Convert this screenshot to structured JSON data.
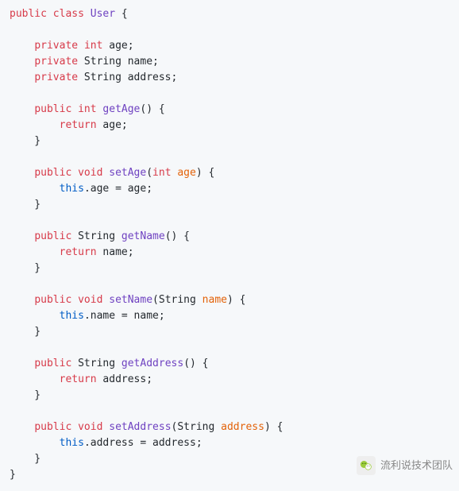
{
  "styles": {
    "kw": "#d73a49",
    "type": "#d73a49",
    "cls": "#6f42c1",
    "fn": "#6f42c1",
    "param": "#e36209",
    "this": "#005cc5",
    "plain": "#24292e"
  },
  "code": {
    "indent": "    ",
    "lines": [
      [
        [
          "kw",
          "public"
        ],
        [
          "plain",
          " "
        ],
        [
          "kw",
          "class"
        ],
        [
          "plain",
          " "
        ],
        [
          "cls",
          "User"
        ],
        [
          "plain",
          " {"
        ]
      ],
      [],
      [
        [
          "plain",
          "    "
        ],
        [
          "kw",
          "private"
        ],
        [
          "plain",
          " "
        ],
        [
          "type",
          "int"
        ],
        [
          "plain",
          " age;"
        ]
      ],
      [
        [
          "plain",
          "    "
        ],
        [
          "kw",
          "private"
        ],
        [
          "plain",
          " String name;"
        ]
      ],
      [
        [
          "plain",
          "    "
        ],
        [
          "kw",
          "private"
        ],
        [
          "plain",
          " String address;"
        ]
      ],
      [],
      [
        [
          "plain",
          "    "
        ],
        [
          "kw",
          "public"
        ],
        [
          "plain",
          " "
        ],
        [
          "type",
          "int"
        ],
        [
          "plain",
          " "
        ],
        [
          "fn",
          "getAge"
        ],
        [
          "plain",
          "() {"
        ]
      ],
      [
        [
          "plain",
          "        "
        ],
        [
          "kw",
          "return"
        ],
        [
          "plain",
          " age;"
        ]
      ],
      [
        [
          "plain",
          "    }"
        ]
      ],
      [],
      [
        [
          "plain",
          "    "
        ],
        [
          "kw",
          "public"
        ],
        [
          "plain",
          " "
        ],
        [
          "type",
          "void"
        ],
        [
          "plain",
          " "
        ],
        [
          "fn",
          "setAge"
        ],
        [
          "plain",
          "("
        ],
        [
          "type",
          "int"
        ],
        [
          "plain",
          " "
        ],
        [
          "param",
          "age"
        ],
        [
          "plain",
          ") {"
        ]
      ],
      [
        [
          "plain",
          "        "
        ],
        [
          "this",
          "this"
        ],
        [
          "plain",
          ".age = age;"
        ]
      ],
      [
        [
          "plain",
          "    }"
        ]
      ],
      [],
      [
        [
          "plain",
          "    "
        ],
        [
          "kw",
          "public"
        ],
        [
          "plain",
          " String "
        ],
        [
          "fn",
          "getName"
        ],
        [
          "plain",
          "() {"
        ]
      ],
      [
        [
          "plain",
          "        "
        ],
        [
          "kw",
          "return"
        ],
        [
          "plain",
          " name;"
        ]
      ],
      [
        [
          "plain",
          "    }"
        ]
      ],
      [],
      [
        [
          "plain",
          "    "
        ],
        [
          "kw",
          "public"
        ],
        [
          "plain",
          " "
        ],
        [
          "type",
          "void"
        ],
        [
          "plain",
          " "
        ],
        [
          "fn",
          "setName"
        ],
        [
          "plain",
          "(String "
        ],
        [
          "param",
          "name"
        ],
        [
          "plain",
          ") {"
        ]
      ],
      [
        [
          "plain",
          "        "
        ],
        [
          "this",
          "this"
        ],
        [
          "plain",
          ".name = name;"
        ]
      ],
      [
        [
          "plain",
          "    }"
        ]
      ],
      [],
      [
        [
          "plain",
          "    "
        ],
        [
          "kw",
          "public"
        ],
        [
          "plain",
          " String "
        ],
        [
          "fn",
          "getAddress"
        ],
        [
          "plain",
          "() {"
        ]
      ],
      [
        [
          "plain",
          "        "
        ],
        [
          "kw",
          "return"
        ],
        [
          "plain",
          " address;"
        ]
      ],
      [
        [
          "plain",
          "    }"
        ]
      ],
      [],
      [
        [
          "plain",
          "    "
        ],
        [
          "kw",
          "public"
        ],
        [
          "plain",
          " "
        ],
        [
          "type",
          "void"
        ],
        [
          "plain",
          " "
        ],
        [
          "fn",
          "setAddress"
        ],
        [
          "plain",
          "(String "
        ],
        [
          "param",
          "address"
        ],
        [
          "plain",
          ") {"
        ]
      ],
      [
        [
          "plain",
          "        "
        ],
        [
          "this",
          "this"
        ],
        [
          "plain",
          ".address = address;"
        ]
      ],
      [
        [
          "plain",
          "    }"
        ]
      ],
      [
        [
          "plain",
          "}"
        ]
      ]
    ]
  },
  "watermark": {
    "text": "流利说技术团队"
  }
}
